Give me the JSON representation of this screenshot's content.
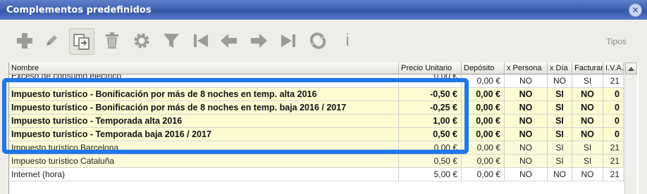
{
  "window": {
    "title": "Complementos predefinidos",
    "close_glyph": "×"
  },
  "toolbar": {
    "buttons": [
      {
        "icon": "add-icon"
      },
      {
        "icon": "edit-icon"
      },
      {
        "icon": "copy-icon"
      },
      {
        "icon": "trash-icon"
      },
      {
        "icon": "gear-icon"
      },
      {
        "icon": "filter-icon"
      },
      {
        "icon": "first-icon"
      },
      {
        "icon": "prev-icon"
      },
      {
        "icon": "next-icon"
      },
      {
        "icon": "last-icon"
      },
      {
        "icon": "refresh-icon"
      },
      {
        "icon": "info-icon"
      }
    ],
    "tipos_label": "Tipos",
    "info_glyph": "i"
  },
  "table": {
    "headers": [
      "Nombre",
      "Precio Unitario",
      "Depósito",
      "x Persona",
      "x Día",
      "Facturar",
      "I.V.A."
    ],
    "rows": [
      {
        "nombre": "Exceso de consumo eléctrico",
        "precio": "0,00 €",
        "deposito": "0,00 €",
        "persona": "NO",
        "dia": "NO",
        "facturar": "SI",
        "iva": "21"
      },
      {
        "nombre": "Impuesto turístico - Bonificación por más de 8 noches en temp. alta 2016",
        "precio": "-0,50 €",
        "deposito": "0,00 €",
        "persona": "NO",
        "dia": "SI",
        "facturar": "NO",
        "iva": "0"
      },
      {
        "nombre": "Impuesto turístico - Bonificación por más de 8 noches en temp. baja 2016 / 2017",
        "precio": "-0,25 €",
        "deposito": "0,00 €",
        "persona": "NO",
        "dia": "SI",
        "facturar": "NO",
        "iva": "0"
      },
      {
        "nombre": "Impuesto turístico - Temporada alta 2016",
        "precio": "1,00 €",
        "deposito": "0,00 €",
        "persona": "NO",
        "dia": "SI",
        "facturar": "NO",
        "iva": "0"
      },
      {
        "nombre": "Impuesto turístico - Temporada baja 2016 / 2017",
        "precio": "0,50 €",
        "deposito": "0,00 €",
        "persona": "NO",
        "dia": "SI",
        "facturar": "NO",
        "iva": "0"
      },
      {
        "nombre": "Impuesto turístico Barcelona",
        "precio": "0,00 €",
        "deposito": "0,00 €",
        "persona": "NO",
        "dia": "SI",
        "facturar": "SI",
        "iva": "21"
      },
      {
        "nombre": "Impuesto turístico Cataluña",
        "precio": "0,50 €",
        "deposito": "0,00 €",
        "persona": "NO",
        "dia": "SI",
        "facturar": "SI",
        "iva": "21"
      },
      {
        "nombre": "Internet (hora)",
        "precio": "5,00 €",
        "deposito": "0,00 €",
        "persona": "NO",
        "dia": "NO",
        "facturar": "NO",
        "iva": "21"
      }
    ]
  },
  "colors": {
    "highlight_border": "#1d78ea",
    "highlighted_rows_bg": "#fcfbd2",
    "titlebar": "#3f62b3"
  }
}
